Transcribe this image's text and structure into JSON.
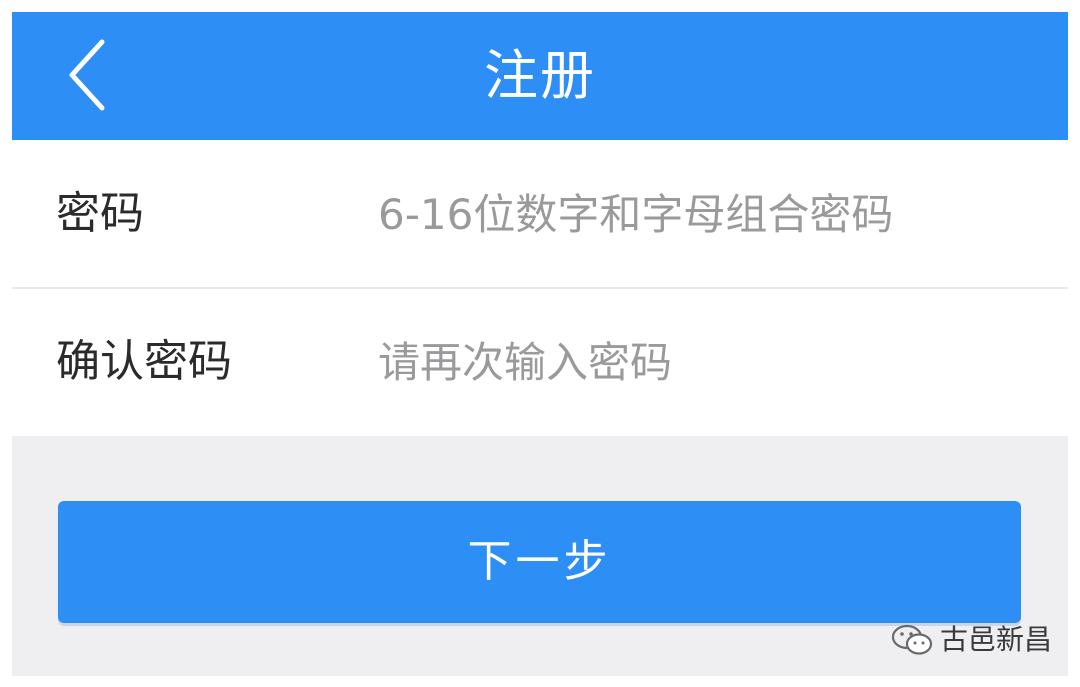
{
  "navbar": {
    "title": "注册",
    "back_icon": "chevron-left-icon",
    "background": "#2d8ff5"
  },
  "form": {
    "password": {
      "label": "密码",
      "placeholder": "6-16位数字和字母组合密码"
    },
    "confirm_password": {
      "label": "确认密码",
      "placeholder": "请再次输入密码"
    }
  },
  "next_button": {
    "label": "下一步",
    "color": "#2d8ff5"
  },
  "watermark": {
    "icon": "wechat-icon",
    "text": "古邑新昌"
  }
}
